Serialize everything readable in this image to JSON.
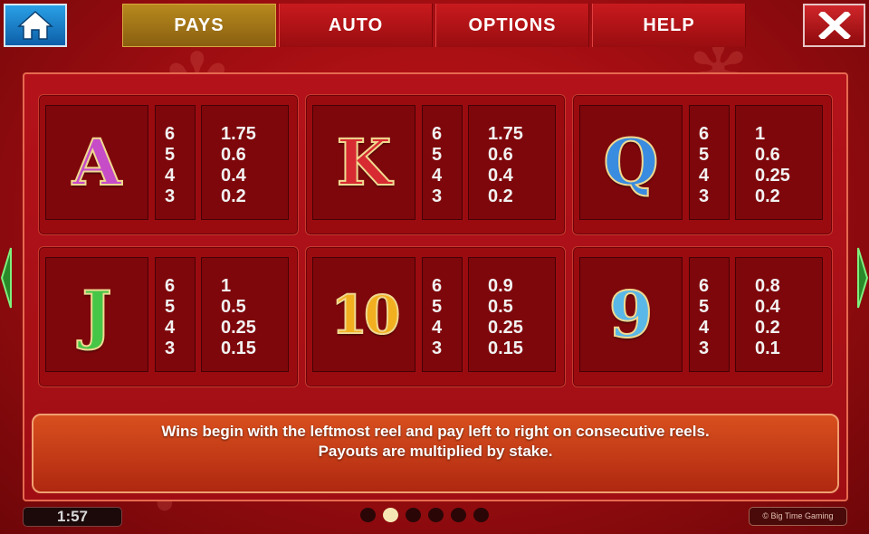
{
  "nav": {
    "tabs": [
      {
        "label": "PAYS",
        "active": true
      },
      {
        "label": "AUTO",
        "active": false
      },
      {
        "label": "OPTIONS",
        "active": false
      },
      {
        "label": "HELP",
        "active": false
      }
    ],
    "home_icon": "home-icon",
    "close_icon": "close-icon"
  },
  "paytable": [
    {
      "symbol": "A",
      "symbol_colors": [
        "#c64cc8",
        "#6a1a78"
      ],
      "counts": [
        "6",
        "5",
        "4",
        "3"
      ],
      "payouts": [
        "1.75",
        "0.6",
        "0.4",
        "0.2"
      ]
    },
    {
      "symbol": "K",
      "symbol_colors": [
        "#e0323a",
        "#7a0a10"
      ],
      "counts": [
        "6",
        "5",
        "4",
        "3"
      ],
      "payouts": [
        "1.75",
        "0.6",
        "0.4",
        "0.2"
      ]
    },
    {
      "symbol": "Q",
      "symbol_colors": [
        "#3a8ce0",
        "#10306a"
      ],
      "counts": [
        "6",
        "5",
        "4",
        "3"
      ],
      "payouts": [
        "1",
        "0.6",
        "0.25",
        "0.2"
      ]
    },
    {
      "symbol": "J",
      "symbol_colors": [
        "#46c646",
        "#10601a"
      ],
      "counts": [
        "6",
        "5",
        "4",
        "3"
      ],
      "payouts": [
        "1",
        "0.5",
        "0.25",
        "0.15"
      ]
    },
    {
      "symbol": "10",
      "symbol_colors": [
        "#f2b020",
        "#8a5008"
      ],
      "counts": [
        "6",
        "5",
        "4",
        "3"
      ],
      "payouts": [
        "0.9",
        "0.5",
        "0.25",
        "0.15"
      ]
    },
    {
      "symbol": "9",
      "symbol_colors": [
        "#5ab8e8",
        "#145a8a"
      ],
      "counts": [
        "6",
        "5",
        "4",
        "3"
      ],
      "payouts": [
        "0.8",
        "0.4",
        "0.2",
        "0.1"
      ]
    }
  ],
  "info": {
    "line1": "Wins begin with the leftmost reel and pay left to right on consecutive reels.",
    "line2": "Payouts are multiplied by stake."
  },
  "footer": {
    "clock": "1:57",
    "pages": 6,
    "active_page": 2,
    "credit": "© Big Time Gaming"
  },
  "colors": {
    "background": "#b4121a",
    "active_tab": "#b8891e",
    "home_button": "#1a7ec8",
    "arrow": "#3ac83a"
  }
}
